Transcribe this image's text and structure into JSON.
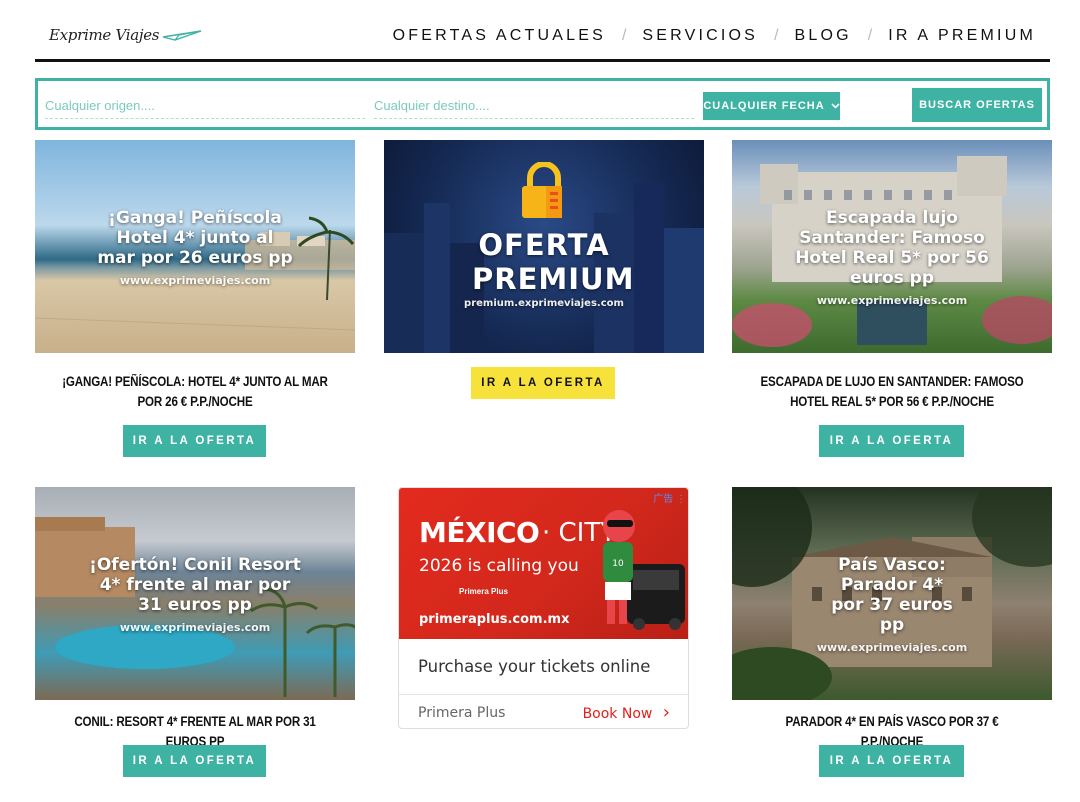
{
  "header": {
    "logo_text": "Exprime Viajes",
    "nav": [
      "OFERTAS ACTUALES",
      "SERVICIOS",
      "BLOG",
      "IR A PREMIUM"
    ]
  },
  "search": {
    "origin_placeholder": "Cualquier origen....",
    "destination_placeholder": "Cualquier destino....",
    "date_label": "CUALQUIER FECHA",
    "submit_label": "BUSCAR OFERTAS"
  },
  "cards": [
    {
      "overlay_title": "¡Ganga! Peñíscola Hotel 4* junto al mar por 26 euros pp",
      "overlay_url": "www.exprimeviajes.com",
      "title": "¡GANGA! PEÑÍSCOLA: HOTEL 4* JUNTO AL MAR POR 26 € P.P./NOCHE",
      "cta": "IR A LA OFERTA"
    },
    {
      "overlay_title": "OFERTA PREMIUM",
      "overlay_url": "premium.exprimeviajes.com",
      "title": "",
      "cta": "IR A LA OFERTA"
    },
    {
      "overlay_title": "Escapada lujo Santander: Famoso Hotel Real 5* por 56 euros pp",
      "overlay_url": "www.exprimeviajes.com",
      "title": "ESCAPADA DE LUJO EN SANTANDER: FAMOSO HOTEL REAL 5* POR 56 € P.P./NOCHE",
      "cta": "IR A LA OFERTA"
    },
    {
      "overlay_title": "¡Ofertón! Conil Resort 4* frente al mar por 31 euros pp",
      "overlay_url": "www.exprimeviajes.com",
      "title": "CONIL: RESORT 4* FRENTE AL MAR POR 31 EUROS PP",
      "cta": "IR A LA OFERTA"
    },
    {
      "overlay_title": "País Vasco: Parador 4* por 37 euros pp",
      "overlay_url": "www.exprimeviajes.com",
      "title": "PARADOR 4* EN PAÍS VASCO POR 37 € P.P./NOCHE",
      "cta": "IR A LA OFERTA"
    }
  ],
  "ad": {
    "chip": "广告 ⋮",
    "headline_bold": "MÉXICO",
    "headline_light": "· CITY",
    "tagline": "2026 is calling you",
    "brand_mark": "Primera Plus",
    "url": "primeraplus.com.mx",
    "body": "Purchase your tickets online",
    "advertiser": "Primera Plus",
    "cta": "Book Now",
    "cta_arrow": "›"
  },
  "colors": {
    "accent": "#3fb3a3",
    "premium_button": "#f7e23b",
    "ad_red": "#e32a1e"
  }
}
